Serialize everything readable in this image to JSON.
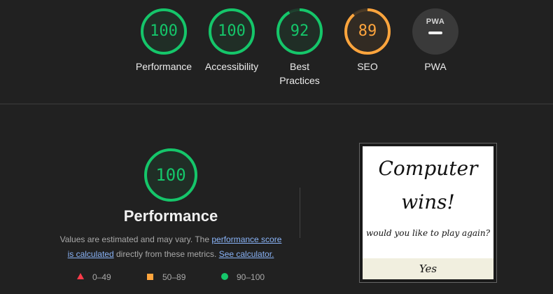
{
  "colors": {
    "pass": "#15c66a",
    "average": "#ffa53d",
    "fail": "#ff3b4a",
    "link": "#8ab4f8"
  },
  "gauges": [
    {
      "score": "100",
      "value": 100,
      "label": "Performance",
      "color": "#15c66a"
    },
    {
      "score": "100",
      "value": 100,
      "label": "Accessibility",
      "color": "#15c66a"
    },
    {
      "score": "92",
      "value": 92,
      "label": "Best Practices",
      "color": "#15c66a"
    },
    {
      "score": "89",
      "value": 89,
      "label": "SEO",
      "color": "#ffa53d"
    },
    {
      "badge": "PWA",
      "label": "PWA"
    }
  ],
  "performance": {
    "score": "100",
    "value": 100,
    "title": "Performance",
    "desc_prefix": "Values are estimated and may vary. The ",
    "link_score": "performance score",
    "link_calculated": "is calculated",
    "desc_middle": " directly from these metrics. ",
    "link_calculator": "See calculator."
  },
  "legend": [
    {
      "shape": "triangle",
      "range": "0–49"
    },
    {
      "shape": "square",
      "range": "50–89"
    },
    {
      "shape": "circle",
      "range": "90–100"
    }
  ],
  "screenshot": {
    "headline_line1": "Computer",
    "headline_line2": "wins!",
    "question": "would you like to play again?",
    "button": "Yes"
  }
}
